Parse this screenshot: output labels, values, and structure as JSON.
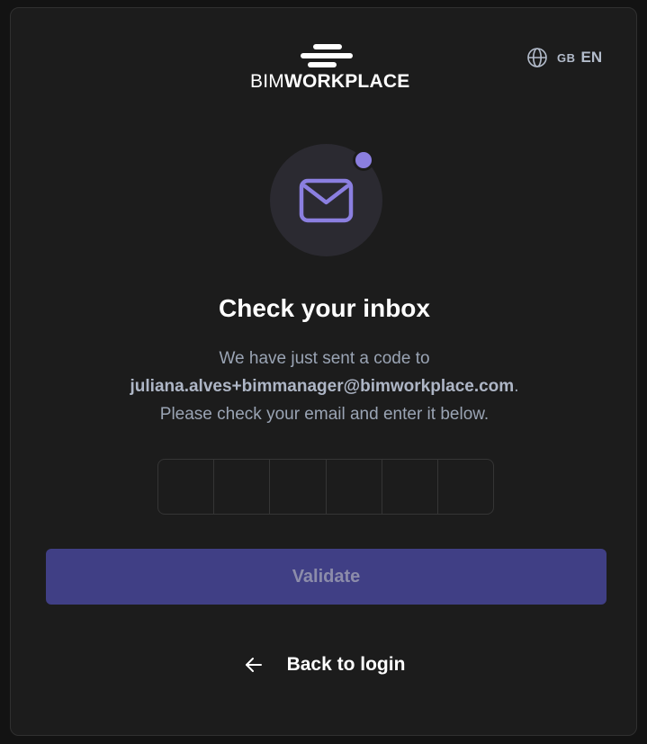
{
  "brand": {
    "name_light": "BIM",
    "name_bold": "WORKPLACE",
    "logo_icon": "bimworkplace-logo-mark"
  },
  "language": {
    "icon": "globe-icon",
    "flag": "GB",
    "code": "EN"
  },
  "hero": {
    "icon": "envelope-icon",
    "badge_color": "#8b7fe0",
    "accent_color": "#8b7fe0"
  },
  "content": {
    "title": "Check your inbox",
    "line1": "We have just sent a code to",
    "email": "juliana.alves+bimmanager@bimworkplace.com",
    "email_suffix": ".",
    "line3": "Please check your email and enter it below."
  },
  "code_input": {
    "digits": [
      "",
      "",
      "",
      "",
      "",
      ""
    ]
  },
  "actions": {
    "validate_label": "Validate",
    "validate_color": "#403f85",
    "back_label": "Back to login",
    "back_icon": "arrow-left-icon"
  }
}
